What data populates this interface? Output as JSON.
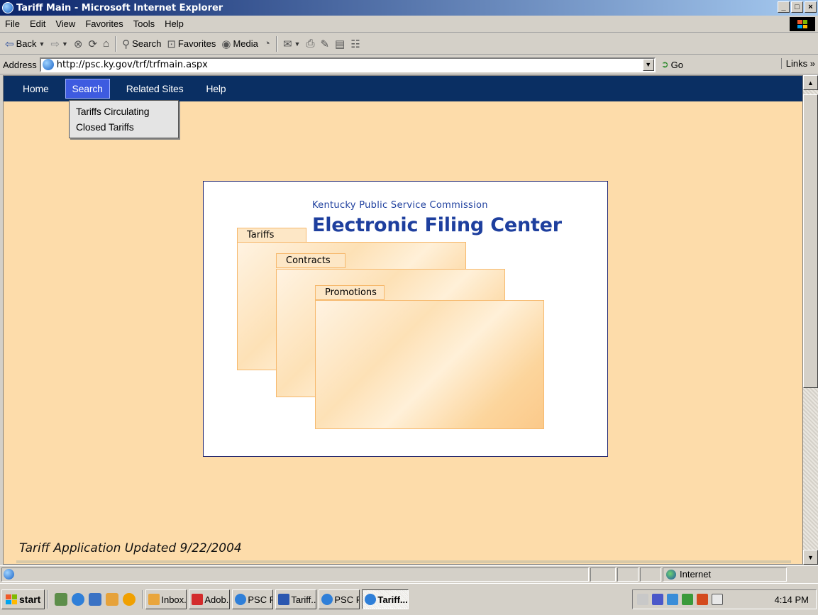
{
  "window": {
    "title": "Tariff Main - Microsoft Internet Explorer",
    "controls": [
      "_",
      "□",
      "×"
    ]
  },
  "menu": [
    "File",
    "Edit",
    "View",
    "Favorites",
    "Tools",
    "Help"
  ],
  "toolbar": {
    "back": "Back",
    "search": "Search",
    "favorites": "Favorites",
    "media": "Media"
  },
  "address": {
    "label": "Address",
    "url": "http://psc.ky.gov/trf/trfmain.aspx",
    "go": "Go",
    "links": "Links »"
  },
  "site_nav": {
    "items": [
      "Home",
      "Search",
      "Related Sites",
      "Help"
    ],
    "active": "Search"
  },
  "search_dropdown": [
    "Tariffs Circulating",
    "Closed Tariffs"
  ],
  "banner": {
    "org": "Kentucky Public Service Commission",
    "title": "Electronic Filing Center",
    "folders": [
      "Tariffs",
      "Contracts",
      "Promotions"
    ]
  },
  "footer": {
    "updated": "Tariff Application Updated 9/22/2004"
  },
  "statusbar": {
    "zone": "Internet"
  },
  "taskbar": {
    "start": "start",
    "tasks": [
      "Inbox...",
      "Adob...",
      "PSC P...",
      "Tariff...",
      "PSC P...",
      "Tariff..."
    ],
    "clock": "4:14 PM"
  },
  "colors": {
    "site_nav_bg": "#0a2f63",
    "nav_active_bg": "#3e5be0",
    "page_bg": "#fddcaa",
    "title_color": "#1e3f9e"
  }
}
